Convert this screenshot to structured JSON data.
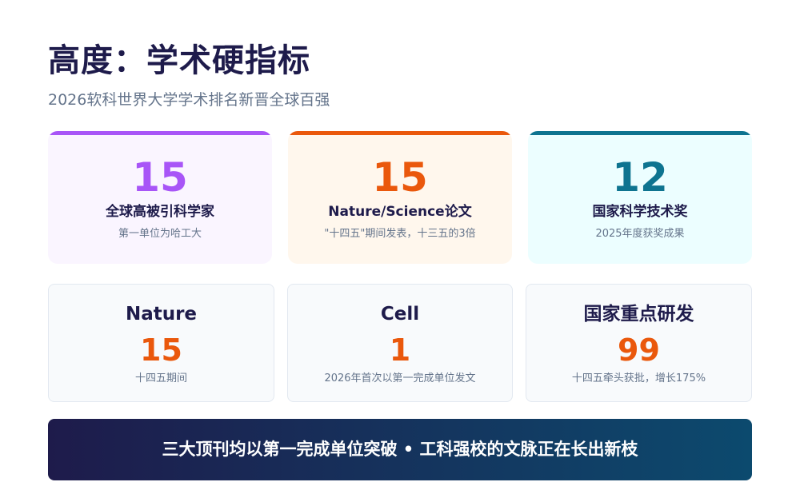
{
  "header": {
    "title": "高度：学术硬指标",
    "subtitle": "2026软科世界大学学术排名新晋全球百强"
  },
  "highlights": [
    {
      "value": "15",
      "label": "全球高被引科学家",
      "note": "第一单位为哈工大",
      "accent": "#a855f7"
    },
    {
      "value": "15",
      "label": "Nature/Science论文",
      "note": "\"十四五\"期间发表，十三五的3倍",
      "accent": "#ea580c"
    },
    {
      "value": "12",
      "label": "国家科学技术奖",
      "note": "2025年度获奖成果",
      "accent": "#0e7490"
    }
  ],
  "metrics": [
    {
      "heading": "Nature",
      "value": "15",
      "note": "十四五期间"
    },
    {
      "heading": "Cell",
      "value": "1",
      "note": "2026年首次以第一完成单位发文"
    },
    {
      "heading": "国家重点研发",
      "value": "99",
      "note": "十四五牵头获批，增长175%"
    }
  ],
  "banner": {
    "text": "三大顶刊均以第一完成单位突破 • 工科强校的文脉正在长出新枝"
  }
}
